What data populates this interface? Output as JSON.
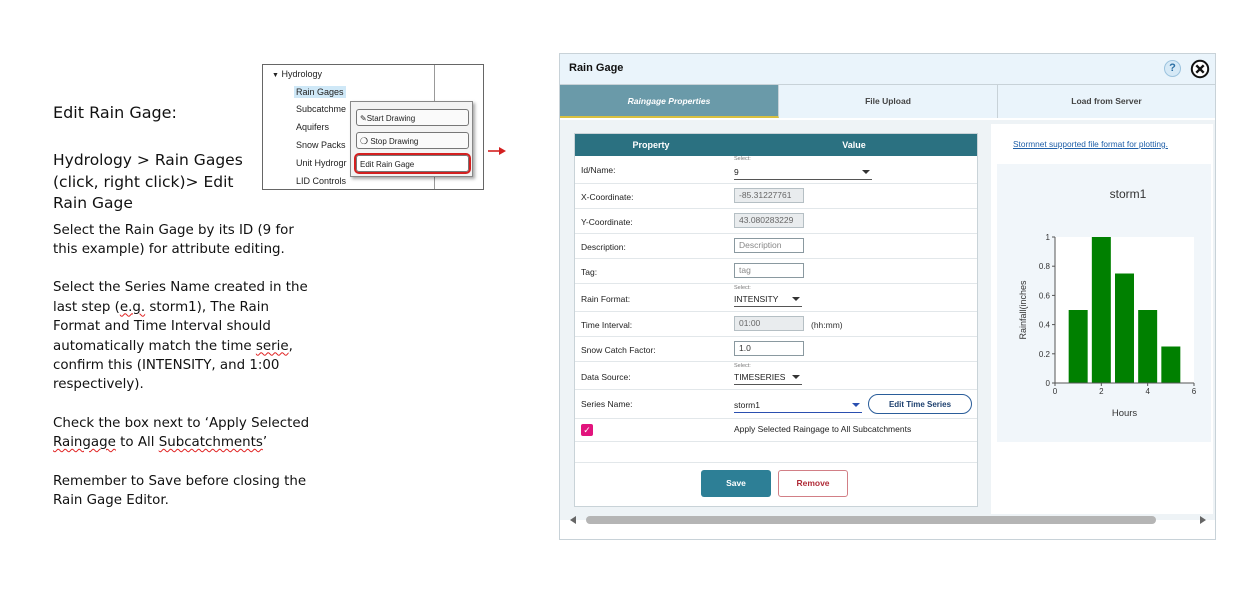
{
  "instructions": {
    "title": "Edit Rain Gage:",
    "path_line1": "Hydrology > Rain Gages",
    "path_line2": "(click, right click)> Edit",
    "path_line3": "Rain Gage",
    "p1": "Select the Rain Gage by its ID (9 for this example) for attribute editing.",
    "p2_a": "Select the Series Name created in the last step (",
    "p2_eg": "e.g.",
    "p2_b": " storm1), The Rain Format and Time Interval should automatically match the time ",
    "p2_serie": "serie",
    "p2_c": ", confirm this (INTENSITY, and 1:00 respectively).",
    "p3_a": "Check the box next to ‘Apply Selected ",
    "p3_raingage": "Raingage",
    "p3_b": " to All ",
    "p3_sub": "Subcatchments",
    "p3_c": "’",
    "p4": "Remember to Save before closing the Rain Gage Editor."
  },
  "tree": {
    "root": "Hydrology",
    "items": [
      "Rain Gages",
      "Subcatchme",
      "Aquifers",
      "Snow Packs",
      "Unit Hydrogr",
      "LID Controls"
    ],
    "context_menu": [
      "Start Drawing",
      "Stop Drawing",
      "Edit Rain Gage"
    ]
  },
  "dialog": {
    "title": "Rain Gage",
    "help": "?",
    "tabs": [
      "Raingage Properties",
      "File Upload",
      "Load from Server"
    ],
    "table_header": {
      "property": "Property",
      "value": "Value"
    },
    "select_caption": "Select:",
    "fields": {
      "id_label": "Id/Name:",
      "id_value": "9",
      "x_label": "X-Coordinate:",
      "x_value": "-85.31227761",
      "y_label": "Y-Coordinate:",
      "y_value": "43.080283229",
      "desc_label": "Description:",
      "desc_placeholder": "Description",
      "tag_label": "Tag:",
      "tag_placeholder": "tag",
      "rainformat_label": "Rain Format:",
      "rainformat_value": "INTENSITY",
      "interval_label": "Time Interval:",
      "interval_value": "01:00",
      "interval_unit": "(hh:mm)",
      "snow_label": "Snow Catch Factor:",
      "snow_value": "1.0",
      "source_label": "Data Source:",
      "source_value": "TIMESERIES",
      "series_label": "Series Name:",
      "series_value": "storm1",
      "edit_ts": "Edit Time Series",
      "apply_all": "Apply Selected Raingage to All Subcatchments"
    },
    "save": "Save",
    "remove": "Remove",
    "format_link": "Stormnet supported file format for plotting."
  },
  "colors": {
    "header_teal": "#2b7181",
    "tab_active": "#6a9aa9",
    "bar_green": "#008000",
    "checkbox": "#e2147d",
    "save": "#2d7f96"
  },
  "chart_data": {
    "type": "bar",
    "title": "storm1",
    "xlabel": "Hours",
    "ylabel": "Rainfall(inches",
    "x": [
      1,
      2,
      3,
      4,
      5
    ],
    "values": [
      0.5,
      1.0,
      0.75,
      0.5,
      0.25
    ],
    "xlim": [
      0,
      6
    ],
    "ylim": [
      0,
      1
    ],
    "xticks": [
      "0",
      "2",
      "4",
      "6"
    ],
    "yticks": [
      "0",
      "0.2",
      "0.4",
      "0.6",
      "0.8",
      "1"
    ],
    "color": "#008000",
    "grid": false
  }
}
